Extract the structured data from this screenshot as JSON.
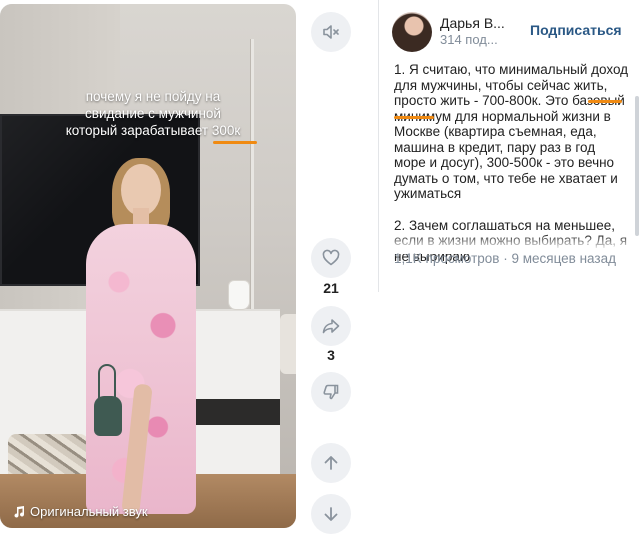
{
  "video": {
    "overlay_lines": [
      "почему я не пойду на",
      "свидание с мужчиной",
      "который зарабатывает 300к"
    ],
    "sound_label": "Оригинальный звук",
    "accent_color": "#f08a12"
  },
  "actions": {
    "mute_icon": "speaker-mute-icon",
    "like_count": "21",
    "share_count": "3"
  },
  "author": {
    "name": "Дарья В...",
    "subtitle": "314 под...",
    "subscribe_label": "Подписаться"
  },
  "description": {
    "paragraph1": "1. Я считаю, что минимальный доход для мужчины, чтобы сейчас жить, просто жить - 700-800к. Это базовый минимум для нормальной жизни в Москве (квартира съемная, еда, машина в кредит, пару раз в год море и досуг), 300-500к - это вечно думать о том, что тебе не хватает и ужиматься",
    "paragraph2": "2. Зачем соглашаться на меньшее, если в жизни можно выбирать? Да, я не выбираю"
  },
  "stats": {
    "text": "1,1K просмотров · 9 месяцев назад"
  }
}
